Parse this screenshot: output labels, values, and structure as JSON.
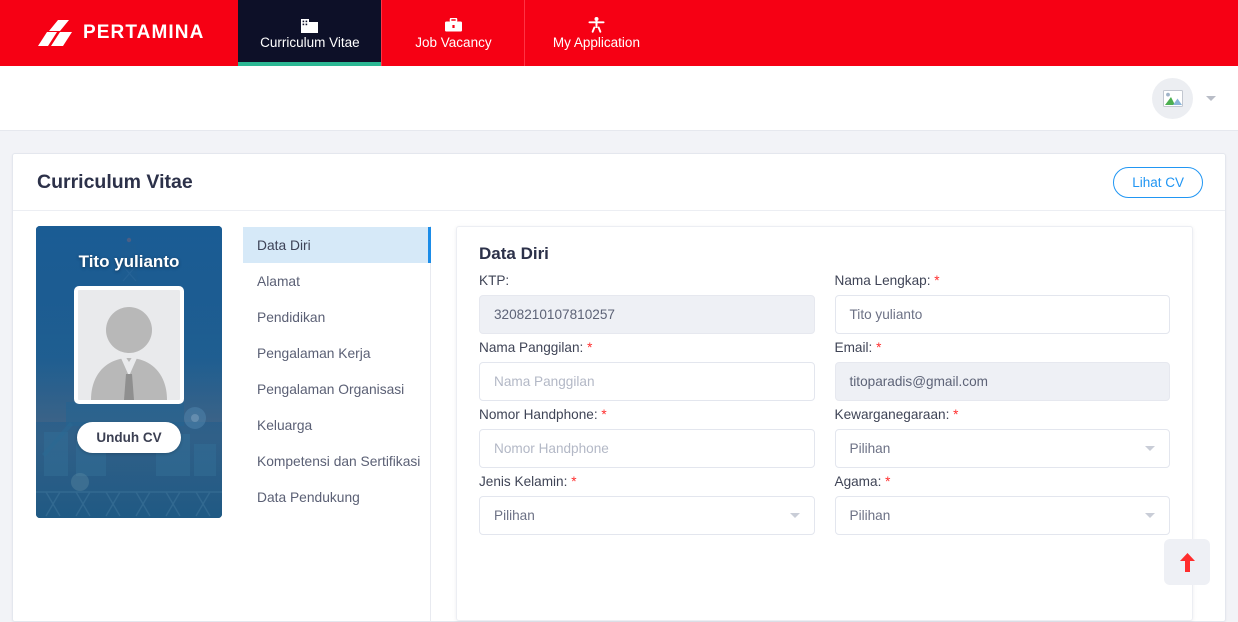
{
  "nav": {
    "brand": "PERTAMINA",
    "brand_color": "#f60014",
    "active_accent": "#2bb793",
    "tabs": [
      {
        "label": "Curriculum Vitae",
        "icon": "building-icon",
        "active": true
      },
      {
        "label": "Job Vacancy",
        "icon": "briefcase-icon",
        "active": false
      },
      {
        "label": "My Application",
        "icon": "person-icon",
        "active": false
      }
    ]
  },
  "userbar": {
    "avatar_icon": "broken-image-icon",
    "caret_icon": "chevron-down-icon"
  },
  "card": {
    "title": "Curriculum Vitae",
    "lihat_cv_label": "Lihat CV",
    "accent_color": "#2196f3"
  },
  "profile": {
    "name": "Tito yulianto",
    "photo_icon": "person-silhouette-icon",
    "unduh_cv_label": "Unduh CV"
  },
  "sidebar": {
    "items": [
      {
        "label": "Data Diri",
        "active": true
      },
      {
        "label": "Alamat",
        "active": false
      },
      {
        "label": "Pendidikan",
        "active": false
      },
      {
        "label": "Pengalaman Kerja",
        "active": false
      },
      {
        "label": "Pengalaman Organisasi",
        "active": false
      },
      {
        "label": "Keluarga",
        "active": false
      },
      {
        "label": "Kompetensi dan Sertifikasi",
        "active": false
      },
      {
        "label": "Data Pendukung",
        "active": false
      }
    ]
  },
  "form": {
    "title": "Data Diri",
    "fields": {
      "ktp": {
        "label": "KTP:",
        "required": false,
        "value": "3208210107810257",
        "disabled": true
      },
      "nama_lengkap": {
        "label": "Nama Lengkap:",
        "required": true,
        "value": "Tito yulianto",
        "disabled": false
      },
      "nama_panggilan": {
        "label": "Nama Panggilan:",
        "required": true,
        "placeholder": "Nama Panggilan",
        "value": "",
        "disabled": false
      },
      "email": {
        "label": "Email:",
        "required": true,
        "value": "titoparadis@gmail.com",
        "disabled": true
      },
      "nomor_handphone": {
        "label": "Nomor Handphone:",
        "required": true,
        "placeholder": "Nomor Handphone",
        "value": "",
        "disabled": false
      },
      "kewarganegaraan": {
        "label": "Kewarganegaraan:",
        "required": true,
        "selected": "Pilihan",
        "type": "select"
      },
      "jenis_kelamin": {
        "label": "Jenis Kelamin:",
        "required": true,
        "selected": "Pilihan",
        "type": "select"
      },
      "agama": {
        "label": "Agama:",
        "required": true,
        "selected": "Pilihan",
        "type": "select"
      }
    }
  },
  "scroll_top": {
    "icon": "arrow-up-icon",
    "color": "#ff2d2d"
  }
}
